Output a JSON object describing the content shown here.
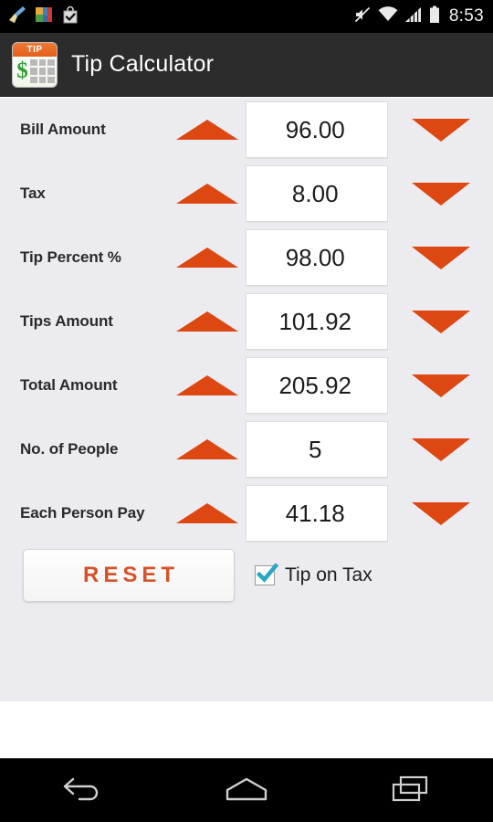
{
  "status_bar": {
    "time": "8:53",
    "left_icons": [
      {
        "name": "cleaner-broom-icon"
      },
      {
        "name": "app-grid-icon"
      },
      {
        "name": "play-store-bag-icon"
      }
    ],
    "right_icons": [
      {
        "name": "volume-mute-icon"
      },
      {
        "name": "wifi-icon"
      },
      {
        "name": "cellular-signal-icon"
      },
      {
        "name": "battery-icon"
      }
    ]
  },
  "action_bar": {
    "title": "Tip Calculator",
    "icon_badge_text": "TIP",
    "icon_currency": "$"
  },
  "colors": {
    "accent_orange": "#dd4711",
    "reset_text": "#d6532a",
    "checkbox_check": "#29a6c4",
    "content_background": "#ecebef",
    "action_bar": "#2c2c2c"
  },
  "rows": [
    {
      "label": "Bill Amount",
      "value": "96.00",
      "increment_icon": "triangle-up-icon",
      "decrement_icon": "triangle-down-icon"
    },
    {
      "label": "Tax",
      "value": "8.00",
      "increment_icon": "triangle-up-icon",
      "decrement_icon": "triangle-down-icon"
    },
    {
      "label": "Tip Percent %",
      "value": "98.00",
      "increment_icon": "triangle-up-icon",
      "decrement_icon": "triangle-down-icon"
    },
    {
      "label": "Tips Amount",
      "value": "101.92",
      "increment_icon": "triangle-up-icon",
      "decrement_icon": "triangle-down-icon"
    },
    {
      "label": "Total Amount",
      "value": "205.92",
      "increment_icon": "triangle-up-icon",
      "decrement_icon": "triangle-down-icon"
    },
    {
      "label": "No. of People",
      "value": "5",
      "increment_icon": "triangle-up-icon",
      "decrement_icon": "triangle-down-icon"
    },
    {
      "label": "Each Person Pay",
      "value": "41.18",
      "increment_icon": "triangle-up-icon",
      "decrement_icon": "triangle-down-icon"
    }
  ],
  "actions": {
    "reset_label": "RESET",
    "tip_on_tax_label": "Tip on Tax",
    "tip_on_tax_checked": true
  },
  "nav_bar": {
    "back_icon": "back-arrow-icon",
    "home_icon": "home-icon",
    "recents_icon": "recent-apps-icon"
  }
}
